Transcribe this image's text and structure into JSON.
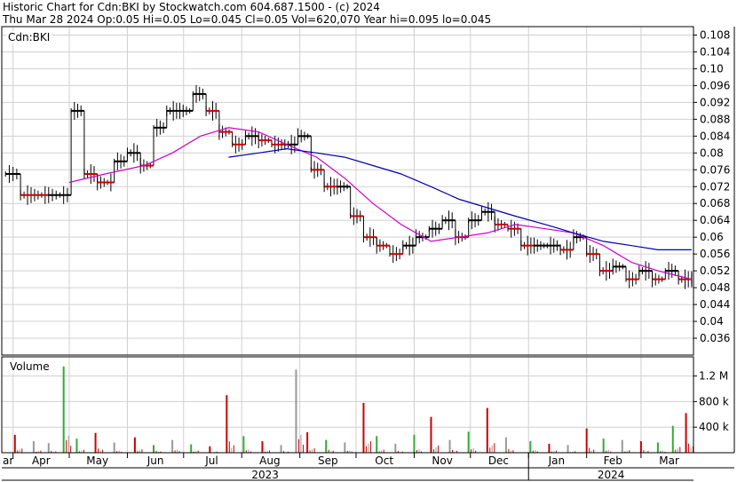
{
  "header": {
    "line1": "Historic Chart for Cdn:BKI by Stockwatch.com 604.687.1500 - (c) 2024",
    "line2": "Thu Mar 28 2024   Op:0.05  Hi=0.05  Lo=0.045  Cl=0.05  Vol=620,070   Year hi=0.095  lo=0.045"
  },
  "price_panel_label": "Cdn:BKI",
  "volume_panel_label": "Volume",
  "colors": {
    "up": "#000000",
    "down": "#cc0000",
    "ma_short": "#cc00cc",
    "ma_long": "#0000aa",
    "grid": "#d0d0d0",
    "volume_bar_up": "#33aa33",
    "volume_bar_down": "#cc0000",
    "volume_bar_neutral": "#999999"
  },
  "chart_data": {
    "type": "line",
    "price_axis": {
      "ylim": [
        0.032,
        0.11
      ],
      "ticks": [
        "0.108",
        "0.104",
        "0.10",
        "0.096",
        "0.092",
        "0.088",
        "0.084",
        "0.08",
        "0.076",
        "0.072",
        "0.068",
        "0.064",
        "0.06",
        "0.056",
        "0.052",
        "0.048",
        "0.044",
        "0.04",
        "0.036"
      ]
    },
    "volume_axis": {
      "ylim": [
        0,
        1500000
      ],
      "ticks": [
        {
          "value": 1200000,
          "label": "1.2 M"
        },
        {
          "value": 800000,
          "label": "800 k"
        },
        {
          "value": 400000,
          "label": "400 k"
        }
      ]
    },
    "x_axis": {
      "month_ticks": [
        "ar",
        "Apr",
        "May",
        "Jun",
        "Jul",
        "Aug",
        "Sep",
        "Oct",
        "Nov",
        "Dec",
        "Jan",
        "Feb",
        "Mar"
      ],
      "year_labels": [
        "2023",
        "2024"
      ]
    },
    "series": [
      {
        "kind": "price_steps",
        "x": [
          "2023-03-28",
          "2023-04-05",
          "2023-04-20",
          "2023-05-02",
          "2023-05-09",
          "2023-05-16",
          "2023-05-25",
          "2023-06-01",
          "2023-06-08",
          "2023-06-15",
          "2023-06-22",
          "2023-06-29",
          "2023-07-06",
          "2023-07-13",
          "2023-07-20",
          "2023-07-27",
          "2023-08-03",
          "2023-08-10",
          "2023-08-17",
          "2023-08-24",
          "2023-08-31",
          "2023-09-07",
          "2023-09-14",
          "2023-09-21",
          "2023-09-28",
          "2023-10-05",
          "2023-10-12",
          "2023-10-19",
          "2023-10-26",
          "2023-11-02",
          "2023-11-09",
          "2023-11-16",
          "2023-11-23",
          "2023-11-30",
          "2023-12-07",
          "2023-12-14",
          "2023-12-21",
          "2023-12-28",
          "2024-01-04",
          "2024-01-11",
          "2024-01-18",
          "2024-01-25",
          "2024-02-01",
          "2024-02-08",
          "2024-02-15",
          "2024-02-22",
          "2024-02-29",
          "2024-03-07",
          "2024-03-14",
          "2024-03-21",
          "2024-03-28"
        ],
        "y": [
          0.075,
          0.07,
          0.07,
          0.09,
          0.075,
          0.073,
          0.078,
          0.08,
          0.077,
          0.086,
          0.09,
          0.09,
          0.094,
          0.09,
          0.085,
          0.082,
          0.084,
          0.083,
          0.082,
          0.082,
          0.084,
          0.076,
          0.072,
          0.072,
          0.065,
          0.06,
          0.058,
          0.056,
          0.058,
          0.06,
          0.062,
          0.064,
          0.06,
          0.064,
          0.066,
          0.063,
          0.062,
          0.058,
          0.058,
          0.058,
          0.057,
          0.06,
          0.056,
          0.052,
          0.053,
          0.05,
          0.052,
          0.05,
          0.052,
          0.05,
          0.05
        ]
      },
      {
        "kind": "moving_average_short",
        "x": [
          "2023-05-01",
          "2023-05-20",
          "2023-06-10",
          "2023-06-25",
          "2023-07-10",
          "2023-07-25",
          "2023-08-10",
          "2023-08-25",
          "2023-09-10",
          "2023-09-25",
          "2023-10-10",
          "2023-10-25",
          "2023-11-10",
          "2023-11-25",
          "2023-12-10",
          "2023-12-25",
          "2024-01-10",
          "2024-01-25",
          "2024-02-10",
          "2024-02-25",
          "2024-03-10",
          "2024-03-28"
        ],
        "y": [
          0.073,
          0.075,
          0.077,
          0.08,
          0.084,
          0.086,
          0.085,
          0.082,
          0.079,
          0.074,
          0.068,
          0.063,
          0.059,
          0.06,
          0.061,
          0.063,
          0.062,
          0.061,
          0.058,
          0.054,
          0.052,
          0.05
        ]
      },
      {
        "kind": "moving_average_long",
        "x": [
          "2023-07-25",
          "2023-08-10",
          "2023-08-25",
          "2023-09-10",
          "2023-09-25",
          "2023-10-10",
          "2023-10-25",
          "2023-11-10",
          "2023-11-25",
          "2023-12-10",
          "2023-12-25",
          "2024-01-10",
          "2024-01-25",
          "2024-02-10",
          "2024-02-25",
          "2024-03-10",
          "2024-03-28"
        ],
        "y": [
          0.079,
          0.08,
          0.081,
          0.08,
          0.079,
          0.077,
          0.075,
          0.072,
          0.069,
          0.067,
          0.065,
          0.063,
          0.061,
          0.059,
          0.058,
          0.057,
          0.057
        ]
      },
      {
        "kind": "volume",
        "x": [
          "2023-04-02",
          "2023-04-12",
          "2023-04-20",
          "2023-04-28",
          "2023-05-05",
          "2023-05-15",
          "2023-05-25",
          "2023-06-05",
          "2023-06-15",
          "2023-06-25",
          "2023-07-05",
          "2023-07-15",
          "2023-07-24",
          "2023-08-02",
          "2023-08-12",
          "2023-08-22",
          "2023-08-30",
          "2023-09-05",
          "2023-09-15",
          "2023-09-25",
          "2023-10-05",
          "2023-10-12",
          "2023-10-22",
          "2023-11-01",
          "2023-11-10",
          "2023-11-20",
          "2023-11-30",
          "2023-12-10",
          "2023-12-20",
          "2024-01-02",
          "2024-01-12",
          "2024-01-22",
          "2024-02-01",
          "2024-02-10",
          "2024-02-20",
          "2024-03-01",
          "2024-03-10",
          "2024-03-18",
          "2024-03-25"
        ],
        "y": [
          280000,
          180000,
          150000,
          1350000,
          220000,
          310000,
          160000,
          240000,
          120000,
          200000,
          130000,
          100000,
          900000,
          260000,
          180000,
          120000,
          1300000,
          320000,
          200000,
          160000,
          780000,
          260000,
          140000,
          280000,
          560000,
          200000,
          330000,
          700000,
          240000,
          180000,
          140000,
          120000,
          380000,
          220000,
          200000,
          180000,
          160000,
          420000,
          620070
        ],
        "direction": [
          "down",
          "neutral",
          "neutral",
          "up",
          "up",
          "down",
          "neutral",
          "down",
          "up",
          "neutral",
          "up",
          "down",
          "down",
          "up",
          "down",
          "neutral",
          "neutral",
          "down",
          "up",
          "neutral",
          "down",
          "up",
          "neutral",
          "up",
          "down",
          "neutral",
          "up",
          "down",
          "neutral",
          "up",
          "down",
          "neutral",
          "down",
          "up",
          "neutral",
          "down",
          "up",
          "up",
          "down"
        ]
      }
    ],
    "grid": true
  }
}
